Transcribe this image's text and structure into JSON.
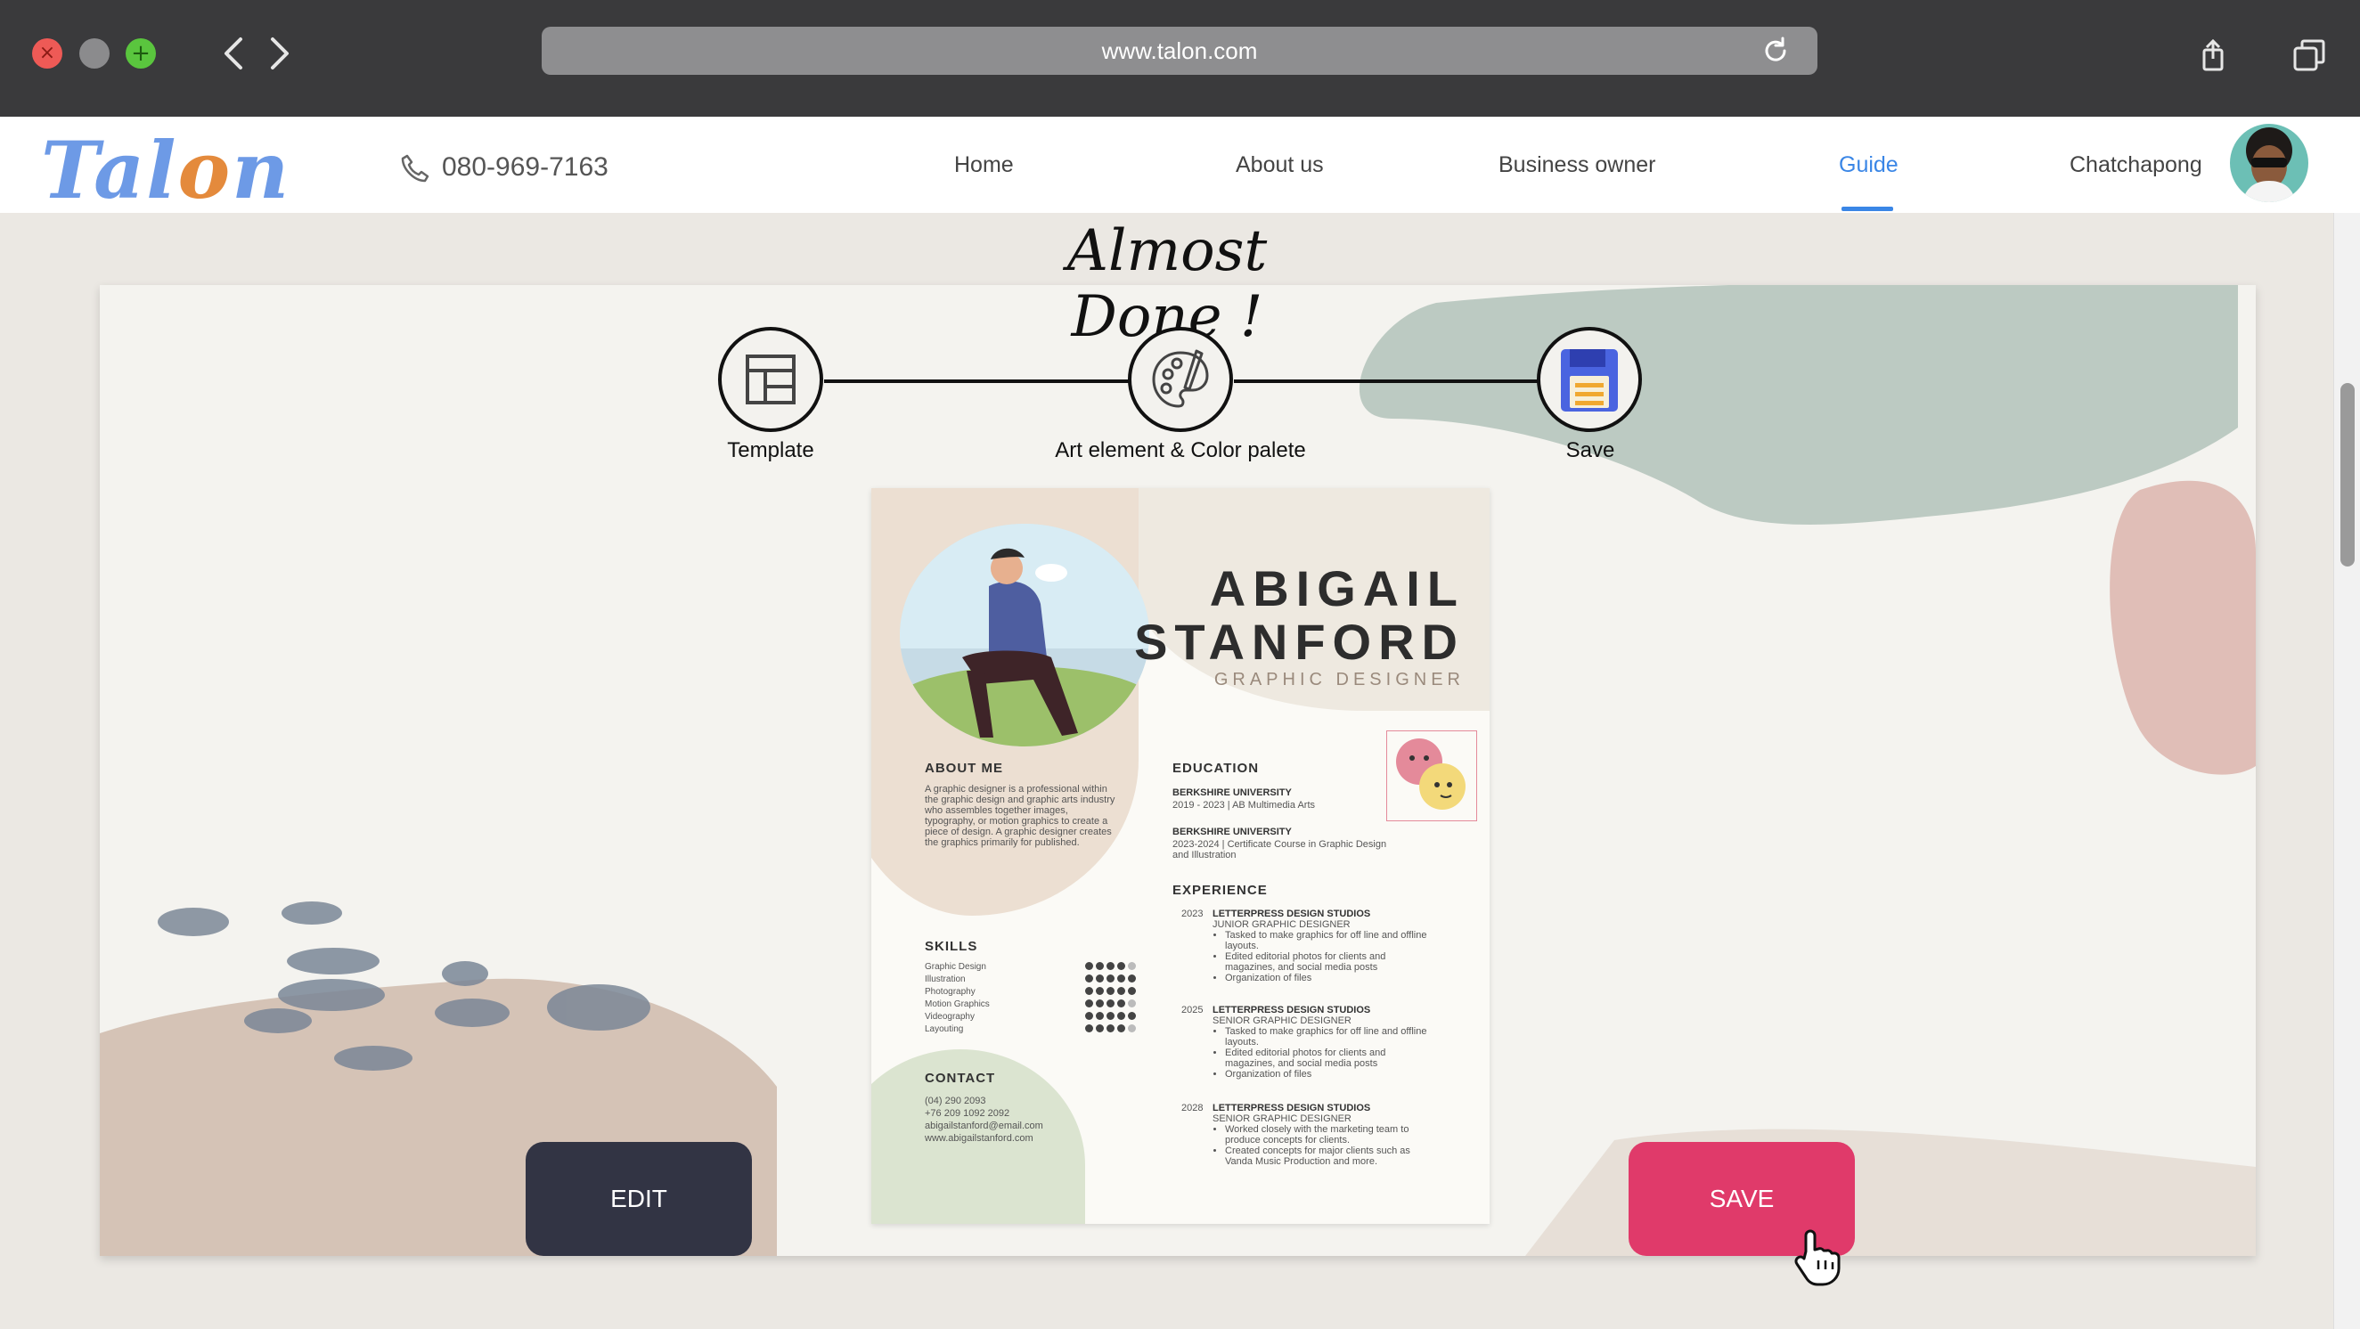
{
  "browser": {
    "url": "www.talon.com",
    "traffic_lights": [
      "close",
      "minimize",
      "fullscreen"
    ]
  },
  "header": {
    "logo": {
      "text": "Talon"
    },
    "phone": "080-969-7163",
    "nav": [
      "Home",
      "About us",
      "Business owner",
      "Guide",
      "Chatchapong"
    ],
    "active_nav": "Guide",
    "accent_color": "#3a86e6"
  },
  "page": {
    "title": "Almost Done !",
    "steps": [
      {
        "label": "Template",
        "icon": "layout-template-icon"
      },
      {
        "label": "Art element & Color palete",
        "icon": "palette-icon"
      },
      {
        "label": "Save",
        "icon": "floppy-disk-icon"
      }
    ],
    "buttons": {
      "edit": "EDIT",
      "save": "SAVE"
    },
    "button_colors": {
      "edit": "#323444",
      "save": "#e03a6a"
    }
  },
  "resume": {
    "first_name": "ABIGAIL",
    "last_name": "STANFORD",
    "role": "GRAPHIC DESIGNER",
    "about_heading": "ABOUT ME",
    "about_text": "A graphic designer is a professional within the graphic design and graphic arts industry who assembles together images, typography, or motion graphics to create a piece of design. A graphic designer creates the graphics primarily for published.",
    "skills_heading": "SKILLS",
    "skills": [
      {
        "name": "Graphic Design",
        "level": 4
      },
      {
        "name": "Illustration",
        "level": 5
      },
      {
        "name": "Photography",
        "level": 5
      },
      {
        "name": "Motion Graphics",
        "level": 4
      },
      {
        "name": "Videography",
        "level": 5
      },
      {
        "name": "Layouting",
        "level": 4
      }
    ],
    "contact_heading": "CONTACT",
    "contact": [
      "(04) 290 2093",
      "+76 209 1092 2092",
      "abigailstanford@email.com",
      "www.abigailstanford.com"
    ],
    "education_heading": "EDUCATION",
    "education": [
      {
        "school": "BERKSHIRE UNIVERSITY",
        "detail": "2019 - 2023 | AB Multimedia Arts"
      },
      {
        "school": "BERKSHIRE UNIVERSITY",
        "detail": "2023-2024 | Certificate Course in Graphic Design and Illustration"
      }
    ],
    "experience_heading": "EXPERIENCE",
    "experience": [
      {
        "year": "2023",
        "company": "LETTERPRESS DESIGN STUDIOS",
        "title": "JUNIOR GRAPHIC DESIGNER",
        "bullets": [
          "Tasked to make graphics for off line and offline layouts.",
          "Edited editorial photos for clients and magazines, and social media posts",
          "Organization of files"
        ]
      },
      {
        "year": "2025",
        "company": "LETTERPRESS DESIGN STUDIOS",
        "title": "SENIOR GRAPHIC DESIGNER",
        "bullets": [
          "Tasked to make graphics for off line and offline layouts.",
          "Edited editorial photos for clients and magazines, and social media posts",
          "Organization of files"
        ]
      },
      {
        "year": "2028",
        "company": "LETTERPRESS DESIGN STUDIOS",
        "title": "SENIOR GRAPHIC DESIGNER",
        "bullets": [
          "Worked closely with the marketing team to produce concepts for clients.",
          "Created concepts for major clients such as Vanda Music Production and more."
        ]
      }
    ]
  }
}
